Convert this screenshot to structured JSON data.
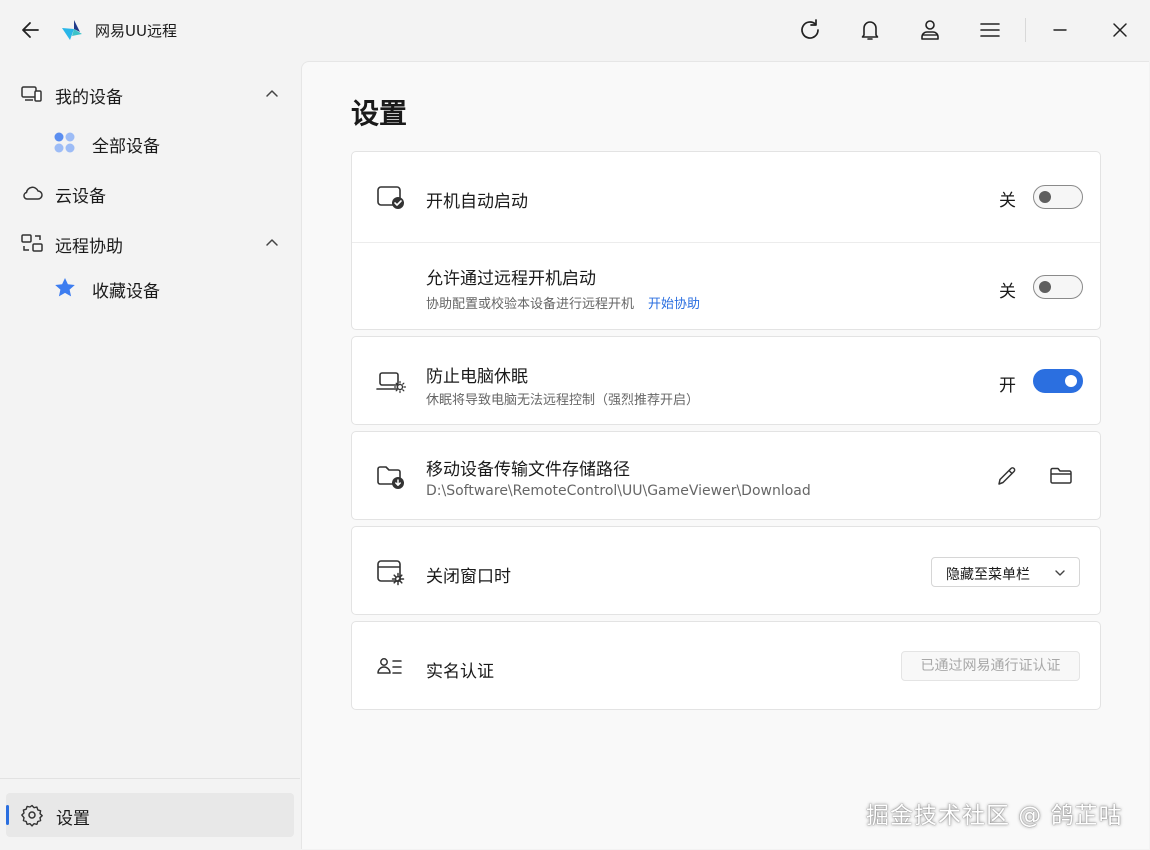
{
  "app": {
    "title": "网易UU远程",
    "brand_color": "#2b6fe0"
  },
  "titlebar": {
    "icons": [
      "back-arrow-icon",
      "app-logo",
      "refresh-icon",
      "bell-icon",
      "user-icon",
      "menu-icon",
      "minimize-icon",
      "close-icon"
    ]
  },
  "sidebar": {
    "my_devices": "我的设备",
    "all_devices": "全部设备",
    "cloud_devices": "云设备",
    "remote_assist": "远程协助",
    "favorites": "收藏设备",
    "settings": "设置"
  },
  "main": {
    "page_title": "设置",
    "autostart": {
      "title": "开机自动启动",
      "state_label": "关",
      "enabled": false
    },
    "remote_boot": {
      "title": "允许通过远程开机启动",
      "description": "协助配置或校验本设备进行远程开机",
      "link": "开始协助",
      "state_label": "关",
      "enabled": false
    },
    "prevent_sleep": {
      "title": "防止电脑休眠",
      "description": "休眠将导致电脑无法远程控制（强烈推荐开启）",
      "state_label": "开",
      "enabled": true
    },
    "storage_path": {
      "title": "移动设备传输文件存储路径",
      "path": "D:\\Software\\RemoteControl\\UU\\GameViewer\\Download"
    },
    "close_window": {
      "title": "关闭窗口时",
      "selected_option": "隐藏至菜单栏"
    },
    "real_name": {
      "title": "实名认证",
      "status_button": "已通过网易通行证认证"
    }
  },
  "watermark": "掘金技术社区 @ 鸽芷咕"
}
